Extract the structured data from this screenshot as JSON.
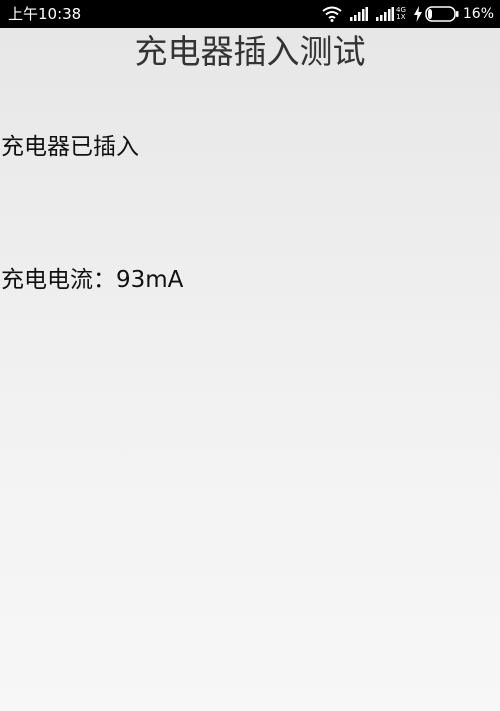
{
  "status_bar": {
    "time": "上午10:38",
    "network_type_top": "4G",
    "network_type_bottom": "1X",
    "battery_percent": "16%",
    "icons": [
      "wifi-icon",
      "signal-icon",
      "signal-icon-secondary",
      "charging-bolt-icon",
      "battery-icon"
    ],
    "battery_level": 0.16
  },
  "page": {
    "title": "充电器插入测试",
    "plug_status": "充电器已插入",
    "current_label": "充电电流：",
    "current_value": "93mA"
  }
}
